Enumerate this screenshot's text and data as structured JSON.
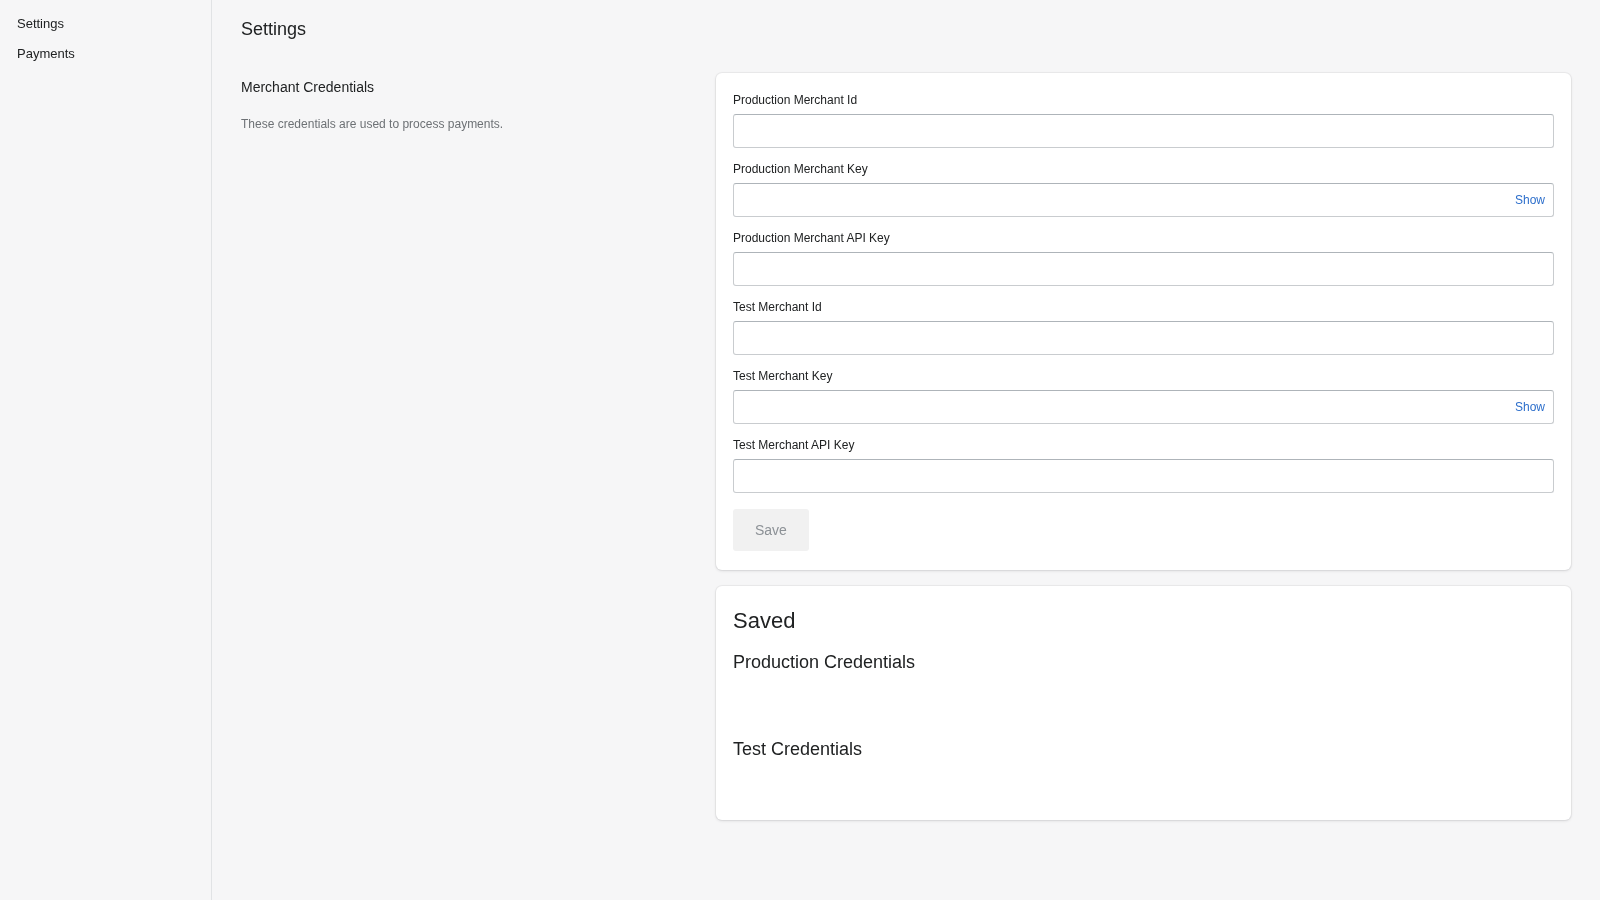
{
  "sidebar": {
    "items": [
      {
        "label": "Settings"
      },
      {
        "label": "Payments"
      }
    ]
  },
  "page_title": "Settings",
  "section": {
    "title": "Merchant Credentials",
    "description": "These credentials are used to process payments."
  },
  "form": {
    "fields": [
      {
        "label": "Production Merchant Id",
        "kind": "text"
      },
      {
        "label": "Production Merchant Key",
        "kind": "secret",
        "toggle": "Show"
      },
      {
        "label": "Production Merchant API Key",
        "kind": "text"
      },
      {
        "label": "Test Merchant Id",
        "kind": "text"
      },
      {
        "label": "Test Merchant Key",
        "kind": "secret",
        "toggle": "Show"
      },
      {
        "label": "Test Merchant API Key",
        "kind": "text"
      }
    ],
    "save_button": {
      "label": "Save",
      "disabled": true
    }
  },
  "saved": {
    "title": "Saved",
    "groups": [
      {
        "title": "Production Credentials"
      },
      {
        "title": "Test Credentials"
      }
    ]
  }
}
